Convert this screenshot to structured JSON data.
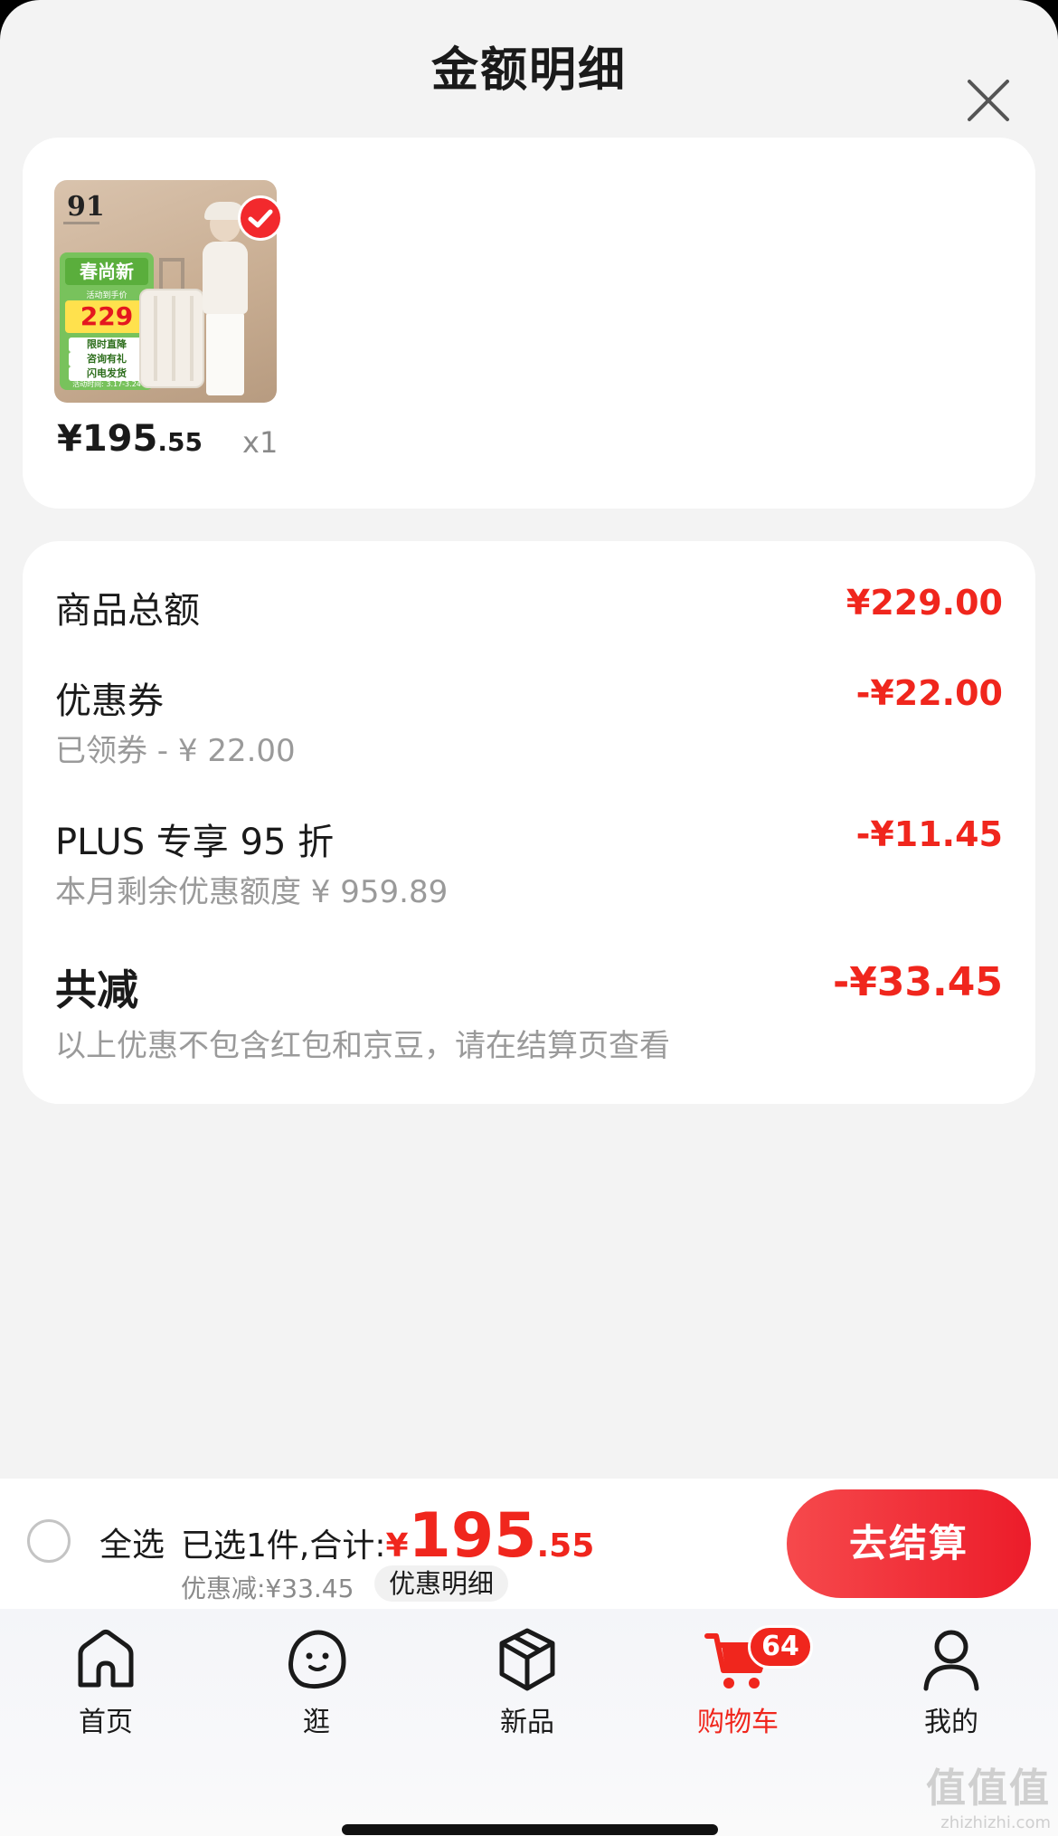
{
  "header": {
    "title": "金额明细"
  },
  "item": {
    "thumb": {
      "promo_title": "春尚新",
      "promo_note": "活动到手价",
      "promo_price": "229",
      "tags": [
        "限时直降",
        "咨询有礼",
        "闪电发货"
      ],
      "promo_date": "活动时间: 3.17-3.24"
    },
    "price_int": "¥195",
    "price_dec": ".55",
    "qty": "x1"
  },
  "breakdown": {
    "total": {
      "label": "商品总额",
      "value": "¥229.00"
    },
    "coupon": {
      "label": "优惠券",
      "sub": "已领券 - ¥ 22.00",
      "value": "-¥22.00"
    },
    "plus": {
      "label": "PLUS 专享 95 折",
      "sub": "本月剩余优惠额度  ¥ 959.89",
      "value": "-¥11.45"
    },
    "saved": {
      "label": "共减",
      "sub": "以上优惠不包含红包和京豆，请在结算页查看",
      "value": "-¥33.45"
    }
  },
  "bottom": {
    "select_all": "全选",
    "summary_prefix": "已选1件,合计:",
    "yen": "¥",
    "total_int": "195",
    "total_dec": ".55",
    "discount": "优惠减:¥33.45",
    "detail_button": "优惠明细",
    "checkout": "去结算"
  },
  "tabs": [
    {
      "label": "首页",
      "icon": "home-icon"
    },
    {
      "label": "逛",
      "icon": "explore-icon"
    },
    {
      "label": "新品",
      "icon": "box-icon"
    },
    {
      "label": "购物车",
      "icon": "cart-icon",
      "badge": "64"
    },
    {
      "label": "我的",
      "icon": "user-icon"
    }
  ],
  "watermark": {
    "line1": "值值值",
    "line2": "zhizhizhi.com"
  },
  "colors": {
    "accent": "#f0261d",
    "checkout": "#ec1c2a",
    "promo_green": "#78c25c"
  }
}
